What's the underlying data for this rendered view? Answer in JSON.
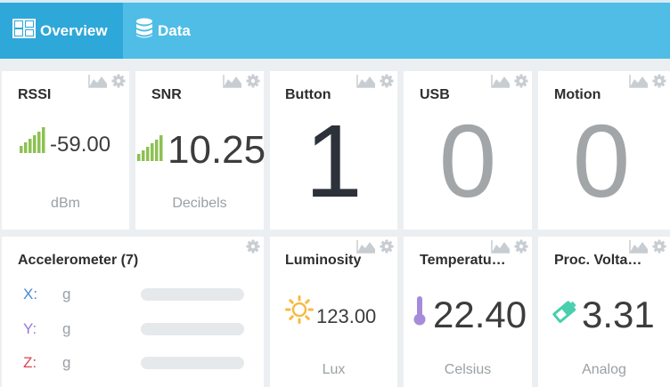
{
  "nav": {
    "tabs": [
      {
        "label": "Overview",
        "icon": "layout-icon",
        "active": true
      },
      {
        "label": "Data",
        "icon": "database-icon",
        "active": false
      }
    ]
  },
  "colors": {
    "topbar": "#4fbde6",
    "active_tab": "#2ea7d9",
    "signal_green": "#8cc152",
    "sun": "#f6bb42",
    "thermometer": "#a78bdb",
    "battery": "#48cfad",
    "axis_x": "#4a89dc",
    "axis_y": "#967adc",
    "axis_z": "#da4453"
  },
  "widgets": {
    "rssi": {
      "title": "RSSI",
      "value": "-59.00",
      "unit": "dBm",
      "icon": "signal-icon"
    },
    "snr": {
      "title": "SNR",
      "value": "10.25",
      "unit": "Decibels",
      "icon": "signal-icon"
    },
    "button": {
      "title": "Button",
      "value": "1"
    },
    "usb": {
      "title": "USB",
      "value": "0"
    },
    "motion": {
      "title": "Motion",
      "value": "0"
    },
    "accelerometer": {
      "title": "Accelerometer (7)",
      "axes": [
        {
          "label": "X:",
          "unit": "g"
        },
        {
          "label": "Y:",
          "unit": "g"
        },
        {
          "label": "Z:",
          "unit": "g"
        }
      ]
    },
    "luminosity": {
      "title": "Luminosity",
      "value": "123.00",
      "unit": "Lux",
      "icon": "sun-icon"
    },
    "temperature": {
      "title": "Temperatu…",
      "value": "22.40",
      "unit": "Celsius",
      "icon": "thermometer-icon"
    },
    "voltage": {
      "title": "Proc. Volta…",
      "value": "3.31",
      "unit": "Analog",
      "icon": "battery-icon"
    }
  }
}
